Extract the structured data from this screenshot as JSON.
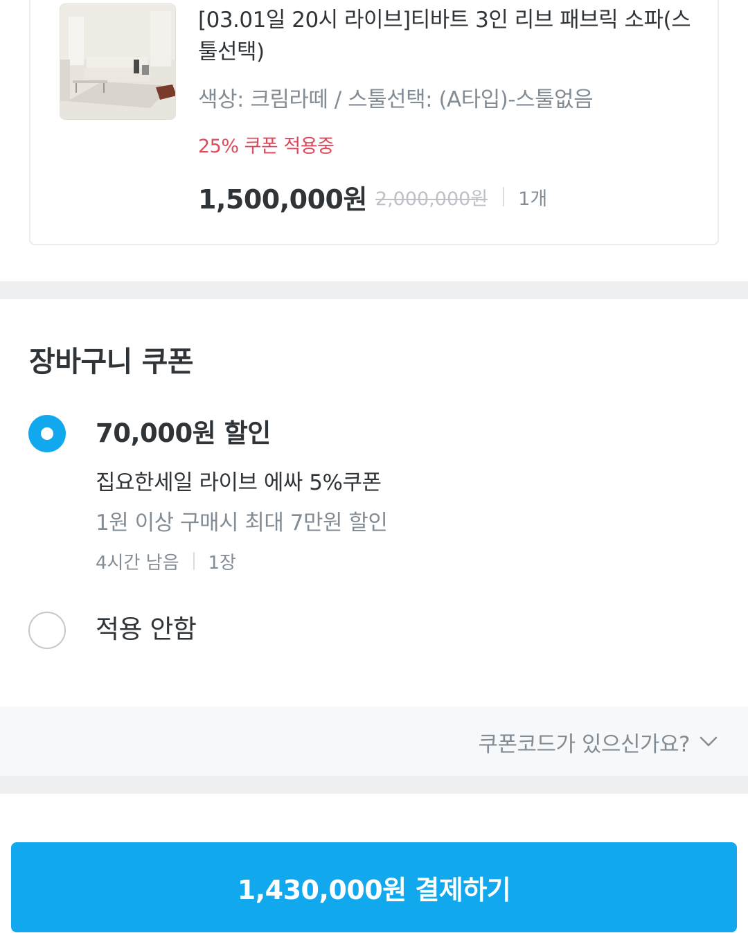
{
  "product": {
    "name": "[03.01일 20시 라이브]티바트 3인 리브 패브릭 소파(스툴선택)",
    "option": "색상: 크림라떼 / 스툴선택: (A타입)-스툴없음",
    "coupon_applied": "25% 쿠폰 적용중",
    "price": "1,500,000원",
    "original_price": "2,000,000원",
    "quantity": "1개"
  },
  "coupon_section": {
    "title": "장바구니 쿠폰",
    "options": [
      {
        "title": "70,000원 할인",
        "name": "집요한세일 라이브 에싸 5%쿠폰",
        "condition": "1원 이상 구매시 최대 7만원 할인",
        "time_left": "4시간 남음",
        "count": "1장",
        "selected": true
      },
      {
        "title": "적용 안함",
        "selected": false
      }
    ],
    "code_prompt": "쿠폰코드가 있으신가요?"
  },
  "pay_button": {
    "label": "1,430,000원 결제하기"
  },
  "colors": {
    "accent": "#12a8ee",
    "coupon_red": "#e0485b",
    "text": "#2f3438",
    "muted": "#828c94"
  },
  "icons": [
    "sofa-thumbnail",
    "radio-selected-icon",
    "radio-unselected-icon",
    "chevron-down-icon"
  ]
}
